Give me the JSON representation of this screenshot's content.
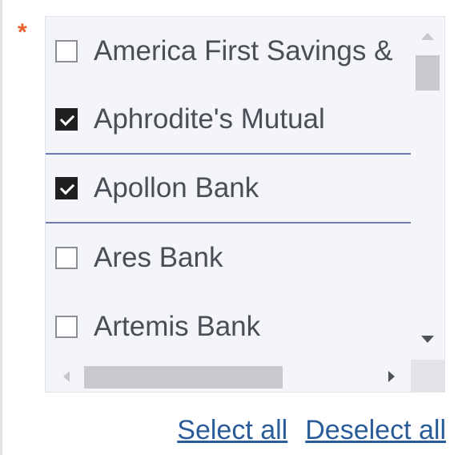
{
  "field": {
    "required_marker": "*"
  },
  "listbox": {
    "items": [
      {
        "label": "America First Savings &",
        "checked": false
      },
      {
        "label": "Aphrodite's Mutual",
        "checked": true
      },
      {
        "label": "Apollon Bank",
        "checked": true
      },
      {
        "label": "Ares Bank",
        "checked": false
      },
      {
        "label": "Artemis Bank",
        "checked": false
      }
    ]
  },
  "actions": {
    "select_all": "Select all",
    "deselect_all": "Deselect all"
  },
  "colors": {
    "required": "#e8632b",
    "link": "#2a5c9a",
    "selection_border": "#6f7ab0",
    "list_background": "#f3f5f9"
  }
}
